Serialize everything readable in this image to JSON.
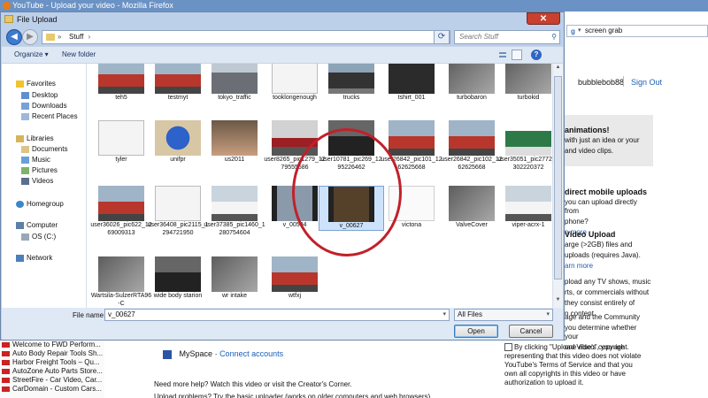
{
  "browser": {
    "title": "YouTube - Upload your video - Mozilla Firefox",
    "search_value": "screen grab"
  },
  "youtube": {
    "username": "bubblebob88",
    "sign_out": "Sign Out",
    "right_panel": [
      {
        "heading": "animations!",
        "lines": [
          "with just an idea or your",
          "and video clips."
        ]
      },
      {
        "heading": "direct mobile uploads",
        "lines": [
          "you can upload directly from",
          "phone?",
          "n more"
        ]
      },
      {
        "heading": "Video Upload",
        "lines": [
          "arge (>2GB) files and",
          "uploads (requires Java).",
          "arn more"
        ]
      },
      {
        "heading": "",
        "lines": [
          "pload any TV shows, music",
          "rts, or commercials without",
          "they consist entirely of",
          "n content."
        ]
      },
      {
        "heading": "",
        "lines": [
          "age and the Community",
          "you determine whether your",
          "one else's copyright."
        ]
      }
    ],
    "upload_notice": "By clicking \"Upload Video\", you are representing that this video does not violate YouTube's Terms of Service and that you own all copyrights in this video or have authorization to upload it.",
    "myspace": "MySpace",
    "connect_accounts": "Connect accounts",
    "help_line1": "Need more help? Watch this video or visit the Creator's Corner.",
    "help_line2": "Upload problems? Try the basic uploader (works on older computers and web browsers).",
    "bookmarks": [
      "Welcome to FWD Perform...",
      "Auto Body Repair Tools Sh...",
      "Harbor Freight Tools – Qu...",
      "AutoZone Auto Parts Store...",
      "StreetFire - Car Video, Car...",
      "CarDomain - Custom Cars..."
    ]
  },
  "dialog": {
    "title": "File Upload",
    "close": "✕",
    "breadcrumb": "Stuff",
    "search_placeholder": "Search Stuff",
    "organize": "Organize ▾",
    "new_folder": "New folder",
    "nav": {
      "favorites": "Favorites",
      "fav_items": [
        "Desktop",
        "Downloads",
        "Recent Places"
      ],
      "libraries": "Libraries",
      "lib_items": [
        "Documents",
        "Music",
        "Pictures",
        "Videos"
      ],
      "homegroup": "Homegroup",
      "computer": "Computer",
      "computer_items": [
        "OS (C:)"
      ],
      "network": "Network"
    },
    "files": [
      {
        "label": "teh5",
        "kind": "car-red"
      },
      {
        "label": "testmyt",
        "kind": "car-red"
      },
      {
        "label": "tokyo_traffic",
        "kind": "street"
      },
      {
        "label": "tooklongenough",
        "kind": "doc"
      },
      {
        "label": "trucks",
        "kind": "truck"
      },
      {
        "label": "tshirt_001",
        "kind": "dark"
      },
      {
        "label": "turbobaron",
        "kind": "engine"
      },
      {
        "label": "turbokid",
        "kind": "engine"
      },
      {
        "label": "tyler",
        "kind": "doc"
      },
      {
        "label": "unifpr",
        "kind": "blue-part"
      },
      {
        "label": "us2011",
        "kind": "people"
      },
      {
        "label": "user8265_pic1279_1279555586",
        "kind": "garage"
      },
      {
        "label": "user10781_pic269_1295226462",
        "kind": "car-dark"
      },
      {
        "label": "user26842_pic101_1262625668",
        "kind": "car-red"
      },
      {
        "label": "user26842_pic102_1262625668",
        "kind": "car-red"
      },
      {
        "label": "user35051_pic2772_1302220372",
        "kind": "car-green"
      },
      {
        "label": "user36026_pic622_1269009313",
        "kind": "car-red"
      },
      {
        "label": "user36408_pic2115_1294721950",
        "kind": "doc"
      },
      {
        "label": "user37385_pic1460_1280754604",
        "kind": "car-white"
      },
      {
        "label": "v_00594",
        "kind": "video"
      },
      {
        "label": "v_00627",
        "kind": "video-selected"
      },
      {
        "label": "victona",
        "kind": "blank"
      },
      {
        "label": "ValveCover",
        "kind": "engine"
      },
      {
        "label": "viper-acrx-1",
        "kind": "car-white"
      },
      {
        "label": "Wartsila-SulzerRTA96-C",
        "kind": "engine"
      },
      {
        "label": "wide body starion",
        "kind": "car-dark"
      },
      {
        "label": "wr intake",
        "kind": "engine"
      },
      {
        "label": "wtfxj",
        "kind": "car-red"
      }
    ],
    "file_name_label": "File name:",
    "file_name_value": "v_00627",
    "file_type": "All Files",
    "open": "Open",
    "cancel": "Cancel"
  },
  "colors": {
    "annotation_circle": "#c2202a",
    "dialog_frame": "#bdd0ea",
    "selection": "#cde3fb"
  }
}
